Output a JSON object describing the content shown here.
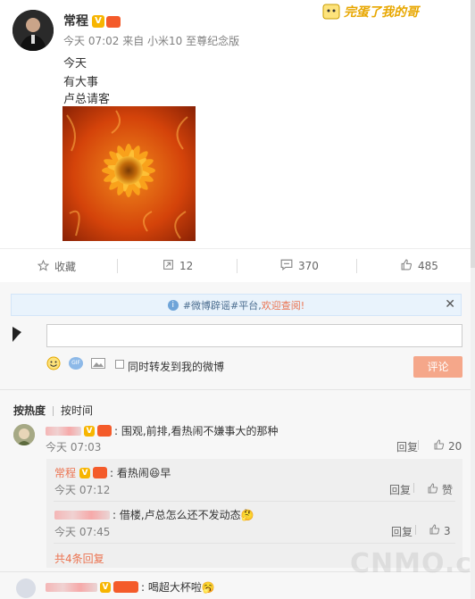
{
  "post": {
    "author": "常程",
    "verified_badge": "V",
    "meta": "今天 07:02 来自 小米10 至尊纪念版",
    "lines": [
      "今天",
      "有大事",
      "卢总请客"
    ]
  },
  "sticker_text": "完蛋了我的哥",
  "actions": {
    "favorite": "收藏",
    "repost": "12",
    "comment": "370",
    "like": "485"
  },
  "notice": {
    "tag": "#微博辟谣#平台,",
    "highlight": "欢迎查阅!"
  },
  "composer": {
    "sync_label": "同时转发到我的微博",
    "submit": "评论",
    "gif": "GIF"
  },
  "sort": {
    "by_hot": "按热度",
    "by_time": "按时间"
  },
  "comments": [
    {
      "text": ": 围观,前排,看热闹不嫌事大的那种",
      "time": "今天 07:03",
      "reply": "回复",
      "likes": "20",
      "replies": [
        {
          "author": "常程",
          "text": ": 看热闹😆早",
          "time": "今天 07:12",
          "reply": "回复",
          "likes": "赞"
        },
        {
          "text": ": 借楼,卢总怎么还不发动态🤔",
          "time": "今天 07:45",
          "reply": "回复",
          "likes": "3"
        }
      ],
      "more": "共4条回复"
    },
    {
      "text": ": 喝超大杯啦🥱"
    }
  ],
  "watermark": "CNMO.com",
  "colors": {
    "accent": "#eb7350",
    "link_blue": "#4b6d8f",
    "submit_bg": "#f5a78a"
  }
}
